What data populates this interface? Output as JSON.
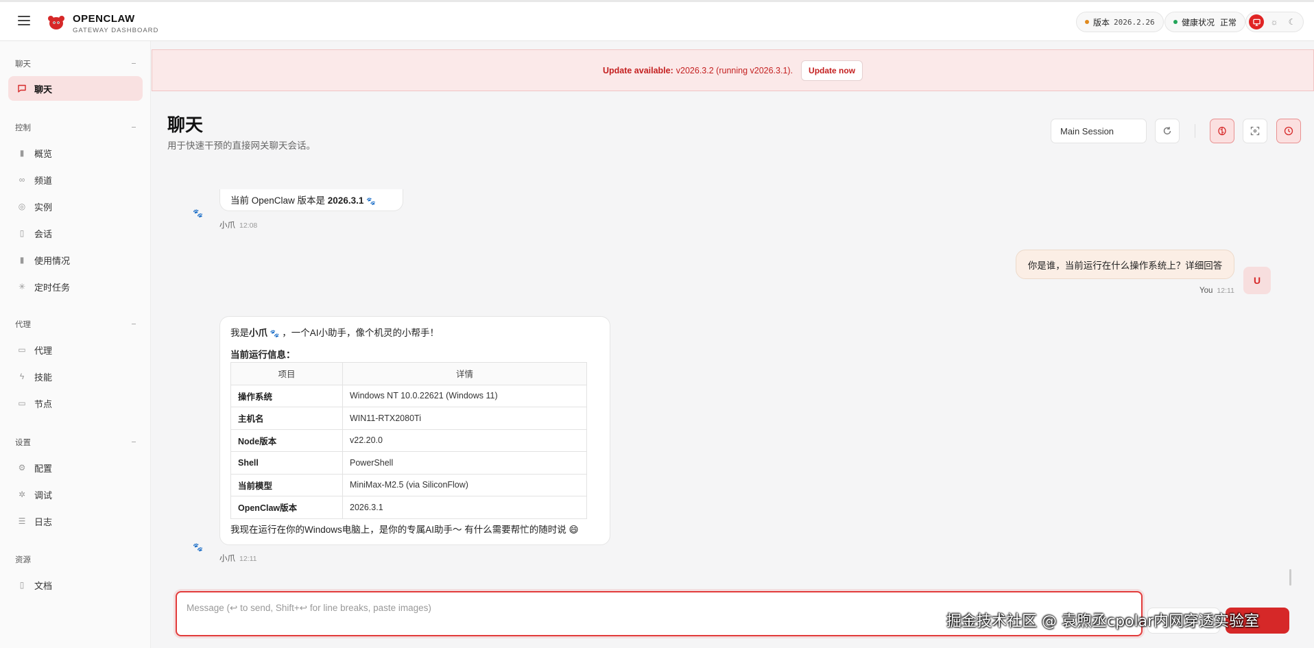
{
  "header": {
    "brand_title": "OPENCLAW",
    "brand_subtitle": "GATEWAY DASHBOARD",
    "version_label": "版本",
    "version_value": "2026.2.26",
    "health_label": "健康状况",
    "health_value": "正常",
    "colors": {
      "accent": "#d62828",
      "version_dot": "#e08a1e",
      "health_dot": "#22a559"
    }
  },
  "sidebar": {
    "groups": [
      {
        "title": "聊天",
        "items": [
          {
            "label": "聊天",
            "icon": "message-icon",
            "active": true
          }
        ]
      },
      {
        "title": "控制",
        "items": [
          {
            "label": "概览",
            "icon": "bar-chart-icon"
          },
          {
            "label": "频道",
            "icon": "link-icon"
          },
          {
            "label": "实例",
            "icon": "radio-icon"
          },
          {
            "label": "会话",
            "icon": "file-icon"
          },
          {
            "label": "使用情况",
            "icon": "bar-chart-icon"
          },
          {
            "label": "定时任务",
            "icon": "loader-icon"
          }
        ]
      },
      {
        "title": "代理",
        "items": [
          {
            "label": "代理",
            "icon": "folder-icon"
          },
          {
            "label": "技能",
            "icon": "bolt-icon"
          },
          {
            "label": "节点",
            "icon": "monitor-icon"
          }
        ]
      },
      {
        "title": "设置",
        "items": [
          {
            "label": "配置",
            "icon": "gear-icon"
          },
          {
            "label": "调试",
            "icon": "bug-icon"
          },
          {
            "label": "日志",
            "icon": "scroll-icon"
          }
        ]
      },
      {
        "title": "资源",
        "items": [
          {
            "label": "文档",
            "icon": "book-icon"
          }
        ]
      }
    ]
  },
  "banner": {
    "prefix": "Update available:",
    "text": "v2026.3.2 (running v2026.3.1).",
    "button": "Update now"
  },
  "page": {
    "title": "聊天",
    "subtitle": "用于快速干预的直接网关聊天会话。",
    "session": "Main Session"
  },
  "messages": {
    "first": {
      "text_prefix": "当前 OpenClaw 版本是 ",
      "text_bold": "2026.3.1",
      "sender": "小爪",
      "time": "12:08"
    },
    "user": {
      "text": "你是谁，当前运行在什么操作系统上？详细回答",
      "sender": "You",
      "time": "12:11",
      "avatar": "U"
    },
    "reply": {
      "intro_prefix": "我是",
      "intro_name": "小爪",
      "intro_suffix": "，一个AI小助手，像个机灵的小帮手！",
      "section_title": "当前运行信息：",
      "table_headers": [
        "项目",
        "详情"
      ],
      "table_rows": [
        [
          "操作系统",
          "Windows NT 10.0.22621 (Windows 11)"
        ],
        [
          "主机名",
          "WIN11-RTX2080Ti"
        ],
        [
          "Node版本",
          "v22.20.0"
        ],
        [
          "Shell",
          "PowerShell"
        ],
        [
          "当前模型",
          "MiniMax-M2.5 (via SiliconFlow)"
        ],
        [
          "OpenClaw版本",
          "2026.3.1"
        ]
      ],
      "closing": "我现在运行在你的Windows电脑上，是你的专属AI助手～ 有什么需要帮忙的随时说 😄",
      "sender": "小爪",
      "time": "12:11"
    }
  },
  "composer": {
    "placeholder": "Message (↩ to send, Shift+↩ for line breaks, paste images)"
  },
  "watermark": "掘金技术社区 @ 袁煦丞cpolar内网穿透实验室"
}
